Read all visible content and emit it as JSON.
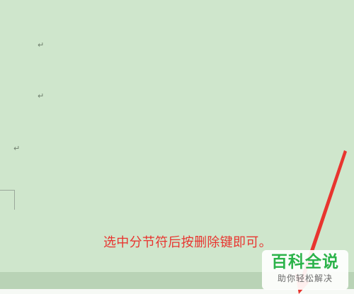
{
  "document": {
    "paragraph_marks": [
      "↵",
      "↵",
      "↵"
    ]
  },
  "annotation": {
    "text": "选中分节符后按删除键即可。",
    "color": "#e8352f"
  },
  "watermark": {
    "title": "百科全说",
    "subtitle": "助你轻松解决",
    "color": "#2bb34a"
  },
  "colors": {
    "page_background": "#cfe6cc",
    "bottom_bar": "#b9d3b6"
  }
}
